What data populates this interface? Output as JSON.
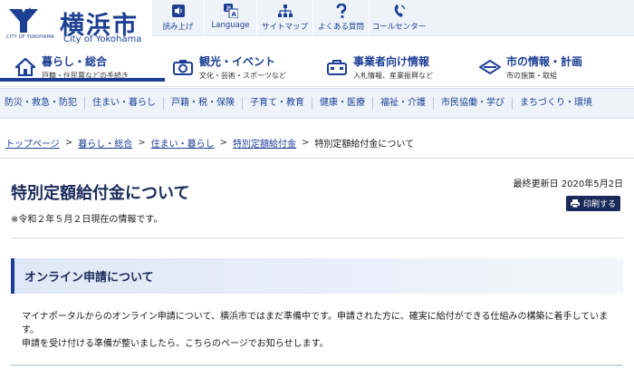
{
  "header": {
    "logo_subtext": "CITY OF YOKOHAMA",
    "logo_title": "横浜市",
    "logo_en": "City of Yokohama",
    "utility": [
      {
        "label": "読み上げ",
        "icon": "speaker-icon"
      },
      {
        "label": "Language",
        "icon": "language-icon"
      },
      {
        "label": "サイトマップ",
        "icon": "sitemap-icon"
      },
      {
        "label": "よくある質問",
        "icon": "question-icon"
      },
      {
        "label": "コールセンター",
        "icon": "phone-icon"
      }
    ]
  },
  "categories": [
    {
      "label": "暮らし・総合",
      "sub": "戸籍・住民票などの手続き",
      "icon": "house-icon"
    },
    {
      "label": "観光・イベント",
      "sub": "文化・芸術・スポーツなど",
      "icon": "camera-icon"
    },
    {
      "label": "事業者向け情報",
      "sub": "入札情報、産業振興など",
      "icon": "business-icon"
    },
    {
      "label": "市の情報・計画",
      "sub": "市の施策・取組",
      "icon": "city-emblem-icon"
    }
  ],
  "subnav": [
    "防災・救急・防犯",
    "住まい・暮らし",
    "戸籍・税・保険",
    "子育て・教育",
    "健康・医療",
    "福祉・介護",
    "市民協働・学び",
    "まちづくり・環境"
  ],
  "breadcrumb": {
    "items": [
      "トップページ",
      "暮らし・総合",
      "住まい・暮らし",
      "特別定額給付金"
    ],
    "current": "特別定額給付金について",
    "separator": ">"
  },
  "page": {
    "title": "特別定額給付金について",
    "updated": "最終更新日 2020年5月2日",
    "print_label": "印刷する",
    "note": "※令和２年５月２日現在の情報です。"
  },
  "section": {
    "heading": "オンライン申請について",
    "para1": "マイナポータルからのオンライン申請について、横浜市ではまだ準備中です。申請された方に、確実に給付ができる仕組みの構築に着手していま",
    "para1b": "す。",
    "para2": "申請を受け付ける準備が整いましたら、こちらのページでお知らせします。"
  },
  "colors": {
    "brand_navy": "#1c3f94",
    "title_navy": "#1a2a5a",
    "nav_bg": "#eef3fa"
  }
}
